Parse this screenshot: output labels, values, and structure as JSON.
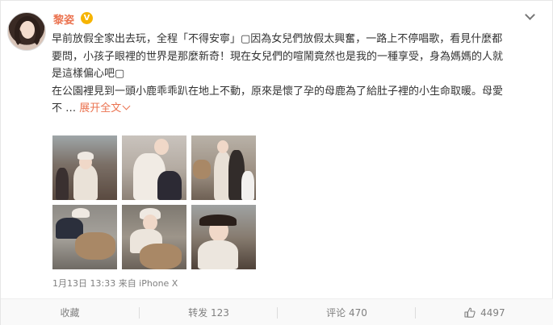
{
  "post": {
    "username": "黎姿",
    "vip_badge": "V",
    "text_lines": [
      "早前放假全家出去玩，全程「不得安寧」▢因為女兒們放假太興奮，一路上不停唱歌，看見什麼都",
      "要問，小孩子眼裡的世界是那麼新奇！現在女兒們的喧鬧竟然也是我的一種享受，身為媽媽的人就",
      "是這樣偏心吧▢",
      "在公園裡見到一頭小鹿乖乖趴在地上不動，原來是懷了孕的母鹿為了給肚子裡的小生命取暖。母愛",
      "不"
    ],
    "ellipsis": " …",
    "expand_label": "展开全文",
    "timestamp": "1月13日 13:33 来自 iPhone X"
  },
  "actions": {
    "favorite_label": "收藏",
    "repost_label": "转发 123",
    "comment_label": "评论 470",
    "like_label": "4497"
  },
  "icons": [
    "avatar",
    "vip-badge-icon",
    "chevron-down-icon",
    "thumbs-up-icon"
  ],
  "colors": {
    "accent": "#eb7350",
    "muted": "#808080",
    "vip": "#f6b400"
  }
}
